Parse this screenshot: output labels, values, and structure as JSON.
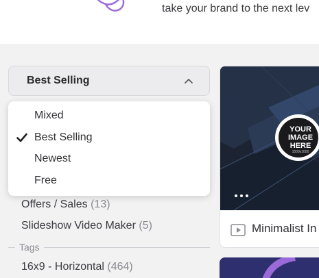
{
  "hero": {
    "tagline": "take your brand to the next lev"
  },
  "sort": {
    "selected_label": "Best Selling",
    "options": [
      {
        "label": "Mixed",
        "selected": false
      },
      {
        "label": "Best Selling",
        "selected": true
      },
      {
        "label": "Newest",
        "selected": false
      },
      {
        "label": "Free",
        "selected": false
      }
    ]
  },
  "filters": {
    "categories": [
      {
        "label": "Offers / Sales",
        "count": "(13)"
      },
      {
        "label": "Slideshow Video Maker",
        "count": "(5)"
      }
    ],
    "tags_heading": "Tags",
    "tags": [
      {
        "label": "16x9 - Horizontal",
        "count": "(464)"
      }
    ]
  },
  "card": {
    "badge_lines": [
      "YOUR",
      "IMAGE",
      "HERE",
      "1500x1000"
    ],
    "title": "Minimalist In",
    "more_icon": "more-dots-icon",
    "media_icon": "video-play-icon"
  },
  "colors": {
    "accent_purple": "#9b6ad9",
    "card_dark": "#1d2a3c"
  }
}
